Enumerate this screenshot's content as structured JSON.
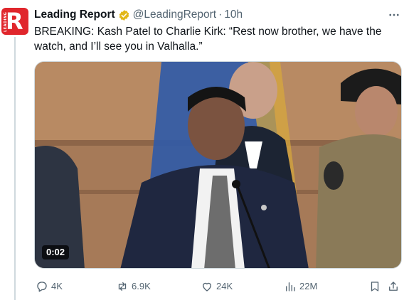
{
  "post": {
    "author_name": "Leading Report",
    "handle": "@LeadingReport",
    "separator": "·",
    "time": "10h",
    "text": "BREAKING: Kash Patel to Charlie Kirk: “Rest now brother, we have the watch, and I’ll see you in Valhalla.”",
    "avatar_letter": "R",
    "avatar_small_text": "LEADING"
  },
  "media": {
    "duration": "0:02"
  },
  "actions": {
    "replies": "4K",
    "reposts": "6.9K",
    "likes": "24K",
    "views": "22M"
  },
  "colors": {
    "brand_red": "#e0262c",
    "verified_gold": "#e2b719",
    "muted": "#536471",
    "text": "#0f1419"
  },
  "icons": [
    "more-icon",
    "verified-badge-icon",
    "reply-icon",
    "repost-icon",
    "like-icon",
    "views-icon",
    "bookmark-icon",
    "share-icon"
  ]
}
